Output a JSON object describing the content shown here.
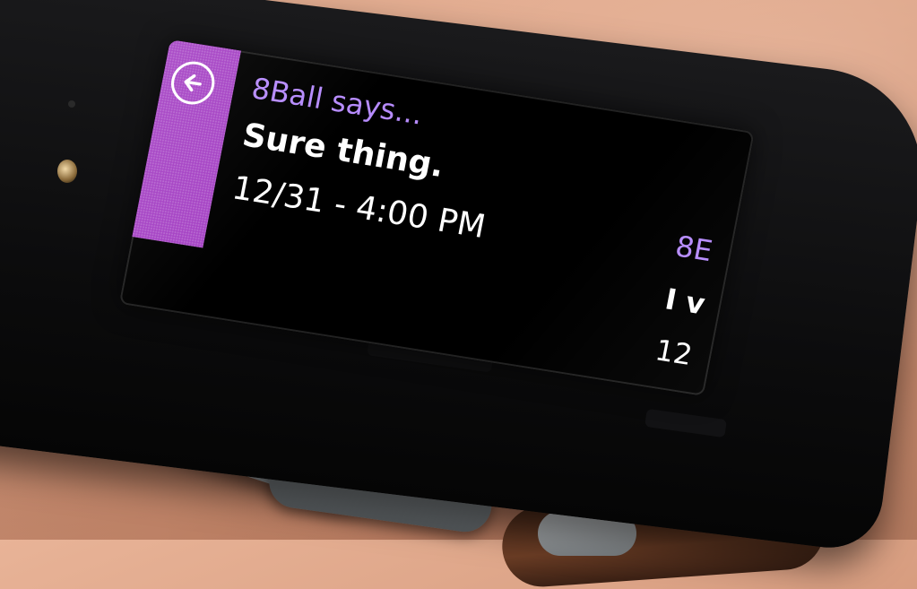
{
  "notification": {
    "sender": "8Ball says...",
    "message": "Sure thing.",
    "timestamp": "12/31 - 4:00 PM",
    "back_icon": "back-arrow-icon"
  },
  "next_notification_peek": {
    "sender": "8E",
    "message": "I v",
    "timestamp": "12"
  },
  "colors": {
    "accent": "#a542c4",
    "sender_text": "#b78cff",
    "screen_bg": "#000000"
  }
}
